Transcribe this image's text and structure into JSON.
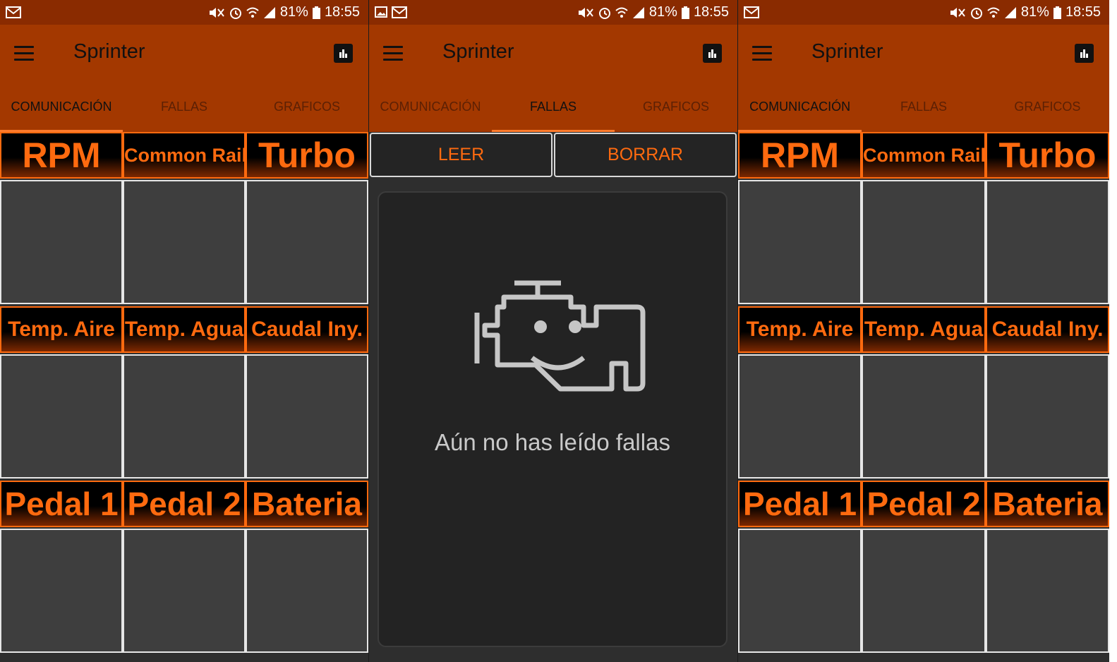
{
  "status": {
    "battery": "81%",
    "time": "18:55"
  },
  "app": {
    "title": "Sprinter"
  },
  "tabs": [
    "COMUNICACIÓN",
    "FALLAS",
    "GRAFICOS"
  ],
  "sensors": [
    "RPM",
    "Common Rail",
    "Turbo",
    "Temp. Aire",
    "Temp. Agua",
    "Caudal Iny.",
    "Pedal 1",
    "Pedal 2",
    "Bateria"
  ],
  "fallas": {
    "read_label": "LEER",
    "clear_label": "BORRAR",
    "empty_message": "Aún no has leído fallas"
  },
  "colors": {
    "appbar": "#a33800",
    "statusbar": "#8a2b00",
    "accent": "#ff6a0f",
    "tile": "#3e3e3e"
  },
  "icons": [
    "menu-icon",
    "chart-icon",
    "check-engine-icon",
    "mail-icon",
    "image-icon",
    "mute-icon",
    "alarm-icon",
    "wifi-icon",
    "signal-icon",
    "battery-icon"
  ]
}
